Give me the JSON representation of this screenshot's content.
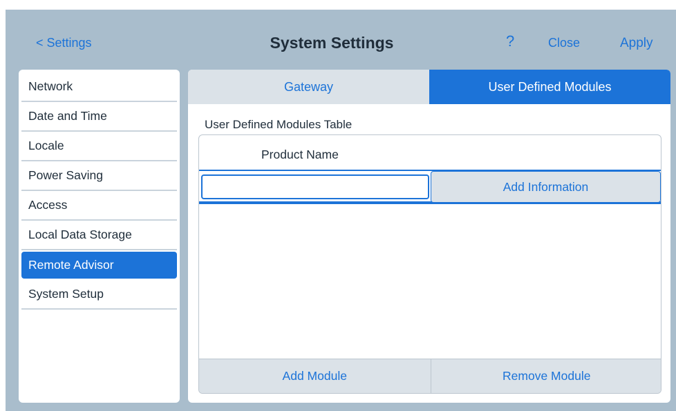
{
  "header": {
    "back_label": "< Settings",
    "title": "System Settings",
    "help_label": "?",
    "close_label": "Close",
    "apply_label": "Apply"
  },
  "sidebar": {
    "items": [
      {
        "label": "Network",
        "active": false
      },
      {
        "label": "Date and Time",
        "active": false
      },
      {
        "label": "Locale",
        "active": false
      },
      {
        "label": "Power Saving",
        "active": false
      },
      {
        "label": "Access",
        "active": false
      },
      {
        "label": "Local Data Storage",
        "active": false
      },
      {
        "label": "Remote Advisor",
        "active": true
      },
      {
        "label": "System Setup",
        "active": false
      }
    ]
  },
  "main": {
    "tabs": [
      {
        "label": "Gateway",
        "active": false
      },
      {
        "label": "User Defined Modules",
        "active": true
      }
    ],
    "section_label": "User Defined Modules Table",
    "table": {
      "column_header": "Product Name",
      "row": {
        "input_value": "",
        "add_info_label": "Add Information"
      }
    },
    "footer": {
      "add_module_label": "Add Module",
      "remove_module_label": "Remove Module"
    }
  },
  "colors": {
    "accent": "#1c73d8",
    "background": "#a9bdcc",
    "panel": "#ffffff",
    "inactive_tab": "#dbe2e8"
  }
}
